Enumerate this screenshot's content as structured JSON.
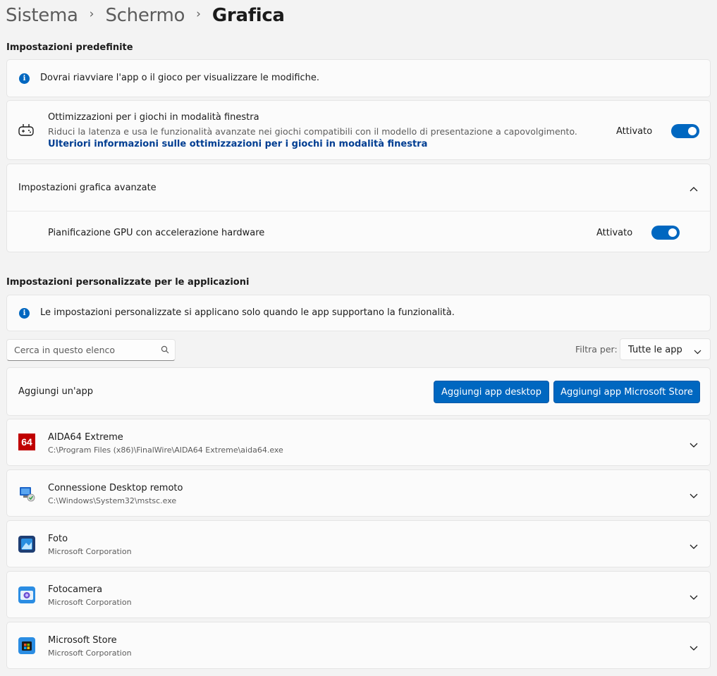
{
  "breadcrumb": [
    "Sistema",
    "Schermo",
    "Grafica"
  ],
  "default_section": {
    "title": "Impostazioni predefinite",
    "info": "Dovrai riavviare l'app o il gioco per visualizzare le modifiche.",
    "windowed_games": {
      "title": "Ottimizzazioni per i giochi in modalità finestra",
      "desc": "Riduci la latenza e usa le funzionalità avanzate nei giochi compatibili con il modello di presentazione a capovolgimento.",
      "link": "Ulteriori informazioni sulle ottimizzazioni per i giochi in modalità finestra",
      "state": "Attivato"
    },
    "advanced": {
      "title": "Impostazioni grafica avanzate",
      "gpu_label": "Pianificazione GPU con accelerazione hardware",
      "state": "Attivato"
    }
  },
  "custom_section": {
    "title": "Impostazioni personalizzate per le applicazioni",
    "info": "Le impostazioni personalizzate si applicano solo quando le app supportano la funzionalità.",
    "search_placeholder": "Cerca in questo elenco",
    "filter_label": "Filtra per:",
    "filter_value": "Tutte le app",
    "add_app_label": "Aggiungi un'app",
    "add_desktop_button": "Aggiungi app desktop",
    "add_store_button": "Aggiungi app Microsoft Store"
  },
  "apps": [
    {
      "name": "AIDA64 Extreme",
      "detail": "C:\\Program Files (x86)\\FinalWire\\AIDA64 Extreme\\aida64.exe",
      "icon": "aida64-icon",
      "icon_text": "64"
    },
    {
      "name": "Connessione Desktop remoto",
      "detail": "C:\\Windows\\System32\\mstsc.exe",
      "icon": "remote-desktop-icon"
    },
    {
      "name": "Foto",
      "detail": "Microsoft Corporation",
      "icon": "photos-icon"
    },
    {
      "name": "Fotocamera",
      "detail": "Microsoft Corporation",
      "icon": "camera-icon"
    },
    {
      "name": "Microsoft Store",
      "detail": "Microsoft Corporation",
      "icon": "store-icon"
    }
  ],
  "colors": {
    "accent": "#0067c0",
    "link": "#003e92",
    "aida_red": "#c00000"
  }
}
